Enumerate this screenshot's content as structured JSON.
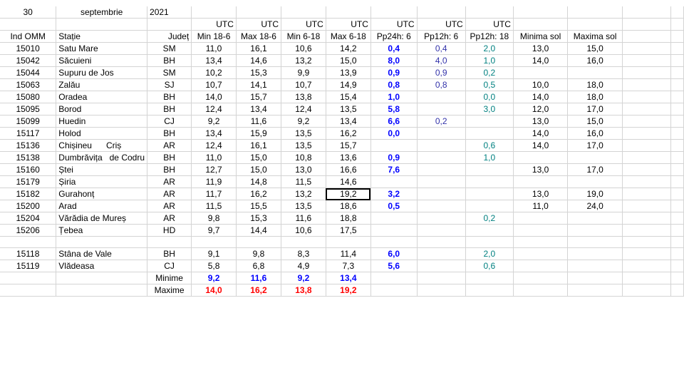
{
  "header": {
    "day": "30",
    "month": "septembrie",
    "year": "2021"
  },
  "utc_label": "UTC",
  "columns": {
    "ind": "Ind OMM",
    "statie": "Stație",
    "judet": "Județ",
    "min186": "Min 18-6",
    "max186": "Max 18-6",
    "min618": "Min 6-18",
    "max618": "Max 6-18",
    "pp24": "Pp24h: 6",
    "pp12a": "Pp12h: 6",
    "pp12b": "Pp12h: 18",
    "minsol": "Minima sol",
    "maxsol": "Maxima sol"
  },
  "rows": [
    {
      "ind": "15010",
      "statie": "Satu Mare",
      "judet": "SM",
      "min186": "11,0",
      "max186": "16,1",
      "min618": "10,6",
      "max618": "14,2",
      "pp24": "0,4",
      "pp12a": "0,4",
      "pp12b": "2,0",
      "minsol": "13,0",
      "maxsol": "15,0"
    },
    {
      "ind": "15042",
      "statie": "Săcuieni",
      "judet": "BH",
      "min186": "13,4",
      "max186": "14,6",
      "min618": "13,2",
      "max618": "15,0",
      "pp24": "8,0",
      "pp12a": "4,0",
      "pp12b": "1,0",
      "minsol": "14,0",
      "maxsol": "16,0"
    },
    {
      "ind": "15044",
      "statie": "Supuru de Jos",
      "judet": "SM",
      "min186": "10,2",
      "max186": "15,3",
      "min618": "9,9",
      "max618": "13,9",
      "pp24": "0,9",
      "pp12a": "0,9",
      "pp12b": "0,2",
      "minsol": "",
      "maxsol": ""
    },
    {
      "ind": "15063",
      "statie": "Zalău",
      "judet": "SJ",
      "min186": "10,7",
      "max186": "14,1",
      "min618": "10,7",
      "max618": "14,9",
      "pp24": "0,8",
      "pp12a": "0,8",
      "pp12b": "0,5",
      "minsol": "10,0",
      "maxsol": "18,0"
    },
    {
      "ind": "15080",
      "statie": "Oradea",
      "judet": "BH",
      "min186": "14,0",
      "max186": "15,7",
      "min618": "13,8",
      "max618": "15,4",
      "pp24": "1,0",
      "pp12a": "",
      "pp12b": "0,0",
      "minsol": "14,0",
      "maxsol": "18,0"
    },
    {
      "ind": "15095",
      "statie": "Borod",
      "judet": "BH",
      "min186": "12,4",
      "max186": "13,4",
      "min618": "12,4",
      "max618": "13,5",
      "pp24": "5,8",
      "pp12a": "",
      "pp12b": "3,0",
      "minsol": "12,0",
      "maxsol": "17,0"
    },
    {
      "ind": "15099",
      "statie": "Huedin",
      "judet": "CJ",
      "min186": "9,2",
      "max186": "11,6",
      "min618": "9,2",
      "max618": "13,4",
      "pp24": "6,6",
      "pp12a": "0,2",
      "pp12b": "",
      "minsol": "13,0",
      "maxsol": "15,0"
    },
    {
      "ind": "15117",
      "statie": "Holod",
      "judet": "BH",
      "min186": "13,4",
      "max186": "15,9",
      "min618": "13,5",
      "max618": "16,2",
      "pp24": "0,0",
      "pp12a": "",
      "pp12b": "",
      "minsol": "14,0",
      "maxsol": "16,0"
    },
    {
      "ind": "15136",
      "statie": "Chișineu      Criș",
      "judet": "AR",
      "min186": "12,4",
      "max186": "16,1",
      "min618": "13,5",
      "max618": "15,7",
      "pp24": "",
      "pp12a": "",
      "pp12b": "0,6",
      "minsol": "14,0",
      "maxsol": "17,0"
    },
    {
      "ind": "15138",
      "statie": "Dumbrăvița   de Codru",
      "judet": "BH",
      "min186": "11,0",
      "max186": "15,0",
      "min618": "10,8",
      "max618": "13,6",
      "pp24": "0,9",
      "pp12a": "",
      "pp12b": "1,0",
      "minsol": "",
      "maxsol": ""
    },
    {
      "ind": "15160",
      "statie": "Ștei",
      "judet": "BH",
      "min186": "12,7",
      "max186": "15,0",
      "min618": "13,0",
      "max618": "16,6",
      "pp24": "7,6",
      "pp12a": "",
      "pp12b": "",
      "minsol": "13,0",
      "maxsol": "17,0"
    },
    {
      "ind": "15179",
      "statie": "Șiria",
      "judet": "AR",
      "min186": "11,9",
      "max186": "14,8",
      "min618": "11,5",
      "max618": "14,6",
      "pp24": "",
      "pp12a": "",
      "pp12b": "",
      "minsol": "",
      "maxsol": ""
    },
    {
      "ind": "15182",
      "statie": "Gurahonț",
      "judet": "AR",
      "min186": "11,7",
      "max186": "16,2",
      "min618": "13,2",
      "max618": "19,2",
      "pp24": "3,2",
      "pp12a": "",
      "pp12b": "",
      "minsol": "13,0",
      "maxsol": "19,0"
    },
    {
      "ind": "15200",
      "statie": "Arad",
      "judet": "AR",
      "min186": "11,5",
      "max186": "15,5",
      "min618": "13,5",
      "max618": "18,6",
      "pp24": "0,5",
      "pp12a": "",
      "pp12b": "",
      "minsol": "11,0",
      "maxsol": "24,0"
    },
    {
      "ind": "15204",
      "statie": "Vărădia de Mureș",
      "judet": "AR",
      "min186": "9,8",
      "max186": "15,3",
      "min618": "11,6",
      "max618": "18,8",
      "pp24": "",
      "pp12a": "",
      "pp12b": "0,2",
      "minsol": "",
      "maxsol": ""
    },
    {
      "ind": "15206",
      "statie": "Țebea",
      "judet": "HD",
      "min186": "9,7",
      "max186": "14,4",
      "min618": "10,6",
      "max618": "17,5",
      "pp24": "",
      "pp12a": "",
      "pp12b": "",
      "minsol": "",
      "maxsol": ""
    },
    {
      "ind": "",
      "statie": "",
      "judet": "",
      "min186": "",
      "max186": "",
      "min618": "",
      "max618": "",
      "pp24": "",
      "pp12a": "",
      "pp12b": "",
      "minsol": "",
      "maxsol": ""
    },
    {
      "ind": "15118",
      "statie": "Stâna de Vale",
      "judet": "BH",
      "min186": "9,1",
      "max186": "9,8",
      "min618": "8,3",
      "max618": "11,4",
      "pp24": "6,0",
      "pp12a": "",
      "pp12b": "2,0",
      "minsol": "",
      "maxsol": ""
    },
    {
      "ind": "15119",
      "statie": "Vlădeasa",
      "judet": "CJ",
      "min186": "5,8",
      "max186": "6,8",
      "min618": "4,9",
      "max618": "7,3",
      "pp24": "5,6",
      "pp12a": "",
      "pp12b": "0,6",
      "minsol": "",
      "maxsol": ""
    }
  ],
  "summary": {
    "min_label": "Minime",
    "max_label": "Maxime",
    "min_values": {
      "min186": "9,2",
      "max186": "11,6",
      "min618": "9,2",
      "max618": "13,4"
    },
    "max_values": {
      "min186": "14,0",
      "max186": "16,2",
      "min618": "13,8",
      "max618": "19,2"
    }
  },
  "colors": {
    "pp24": "#0000ff",
    "pp12a": "#3333aa",
    "pp12b": "#008080",
    "min_summary": "#0000ff",
    "max_summary": "#ff0000",
    "grid": "#d4d4d4"
  }
}
